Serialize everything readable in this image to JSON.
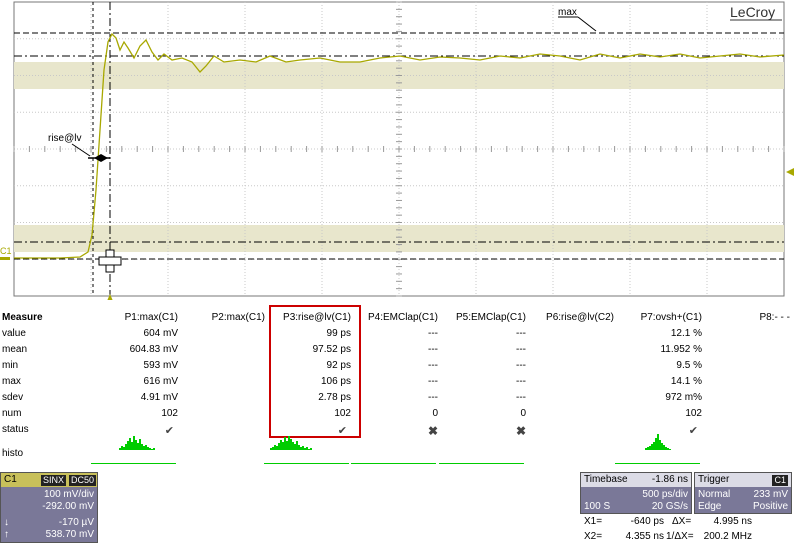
{
  "brand": "LeCroy",
  "scope": {
    "channel_label": "C1",
    "marker_max": "max",
    "marker_rise": "rise@lv",
    "trace_color": "#a8a800",
    "band_color": "#e8e6cc"
  },
  "measure": {
    "title": "Measure",
    "columns": [
      "P1:max(C1)",
      "P2:max(C1)",
      "P3:rise@lv(C1)",
      "P4:EMClap(C1)",
      "P5:EMClap(C1)",
      "P6:rise@lv(C2)",
      "P7:ovsh+(C1)",
      "P8:- - -"
    ],
    "row_labels": {
      "value": "value",
      "mean": "mean",
      "min": "min",
      "max": "max",
      "sdev": "sdev",
      "num": "num",
      "status": "status",
      "histo": "histo"
    },
    "p1": {
      "value": "604 mV",
      "mean": "604.83 mV",
      "min": "593 mV",
      "max": "616 mV",
      "sdev": "4.91 mV",
      "num": "102",
      "status": "✔"
    },
    "p3": {
      "value": "99 ps",
      "mean": "97.52 ps",
      "min": "92 ps",
      "max": "106 ps",
      "sdev": "2.78 ps",
      "num": "102",
      "status": "✔"
    },
    "p4": {
      "value": "---",
      "mean": "---",
      "min": "---",
      "max": "---",
      "sdev": "---",
      "num": "0",
      "status": "✖"
    },
    "p5": {
      "value": "---",
      "mean": "---",
      "min": "---",
      "max": "---",
      "sdev": "---",
      "num": "0",
      "status": "✖"
    },
    "p7": {
      "value": "12.1 %",
      "mean": "11.952 %",
      "min": "9.5 %",
      "max": "14.1 %",
      "sdev": "972 m%",
      "num": "102",
      "status": "✔"
    }
  },
  "channel_panel": {
    "name": "C1",
    "badge1": "SINX",
    "badge2": "DC50",
    "vdiv": "100 mV/div",
    "offset": "-292.00 mV",
    "cursor1_symbol": "↓",
    "cursor1": "-170 µV",
    "cursor2_symbol": "↑",
    "cursor2": "538.70 mV"
  },
  "timebase": {
    "label": "Timebase",
    "delay": "-1.86 ns",
    "tdiv": "500 ps/div",
    "samples": "100 S",
    "rate": "20 GS/s"
  },
  "trigger": {
    "label": "Trigger",
    "badge": "C1",
    "mode": "Normal",
    "level": "233 mV",
    "type": "Edge",
    "slope": "Positive"
  },
  "cursors": {
    "x1_label": "X1=",
    "x1": "-640 ps",
    "dx_label": "ΔX=",
    "dx": "4.995 ns",
    "x2_label": "X2=",
    "x2": "4.355 ns",
    "inv_dx_label": "1/ΔX=",
    "inv_dx": "200.2 MHz"
  }
}
